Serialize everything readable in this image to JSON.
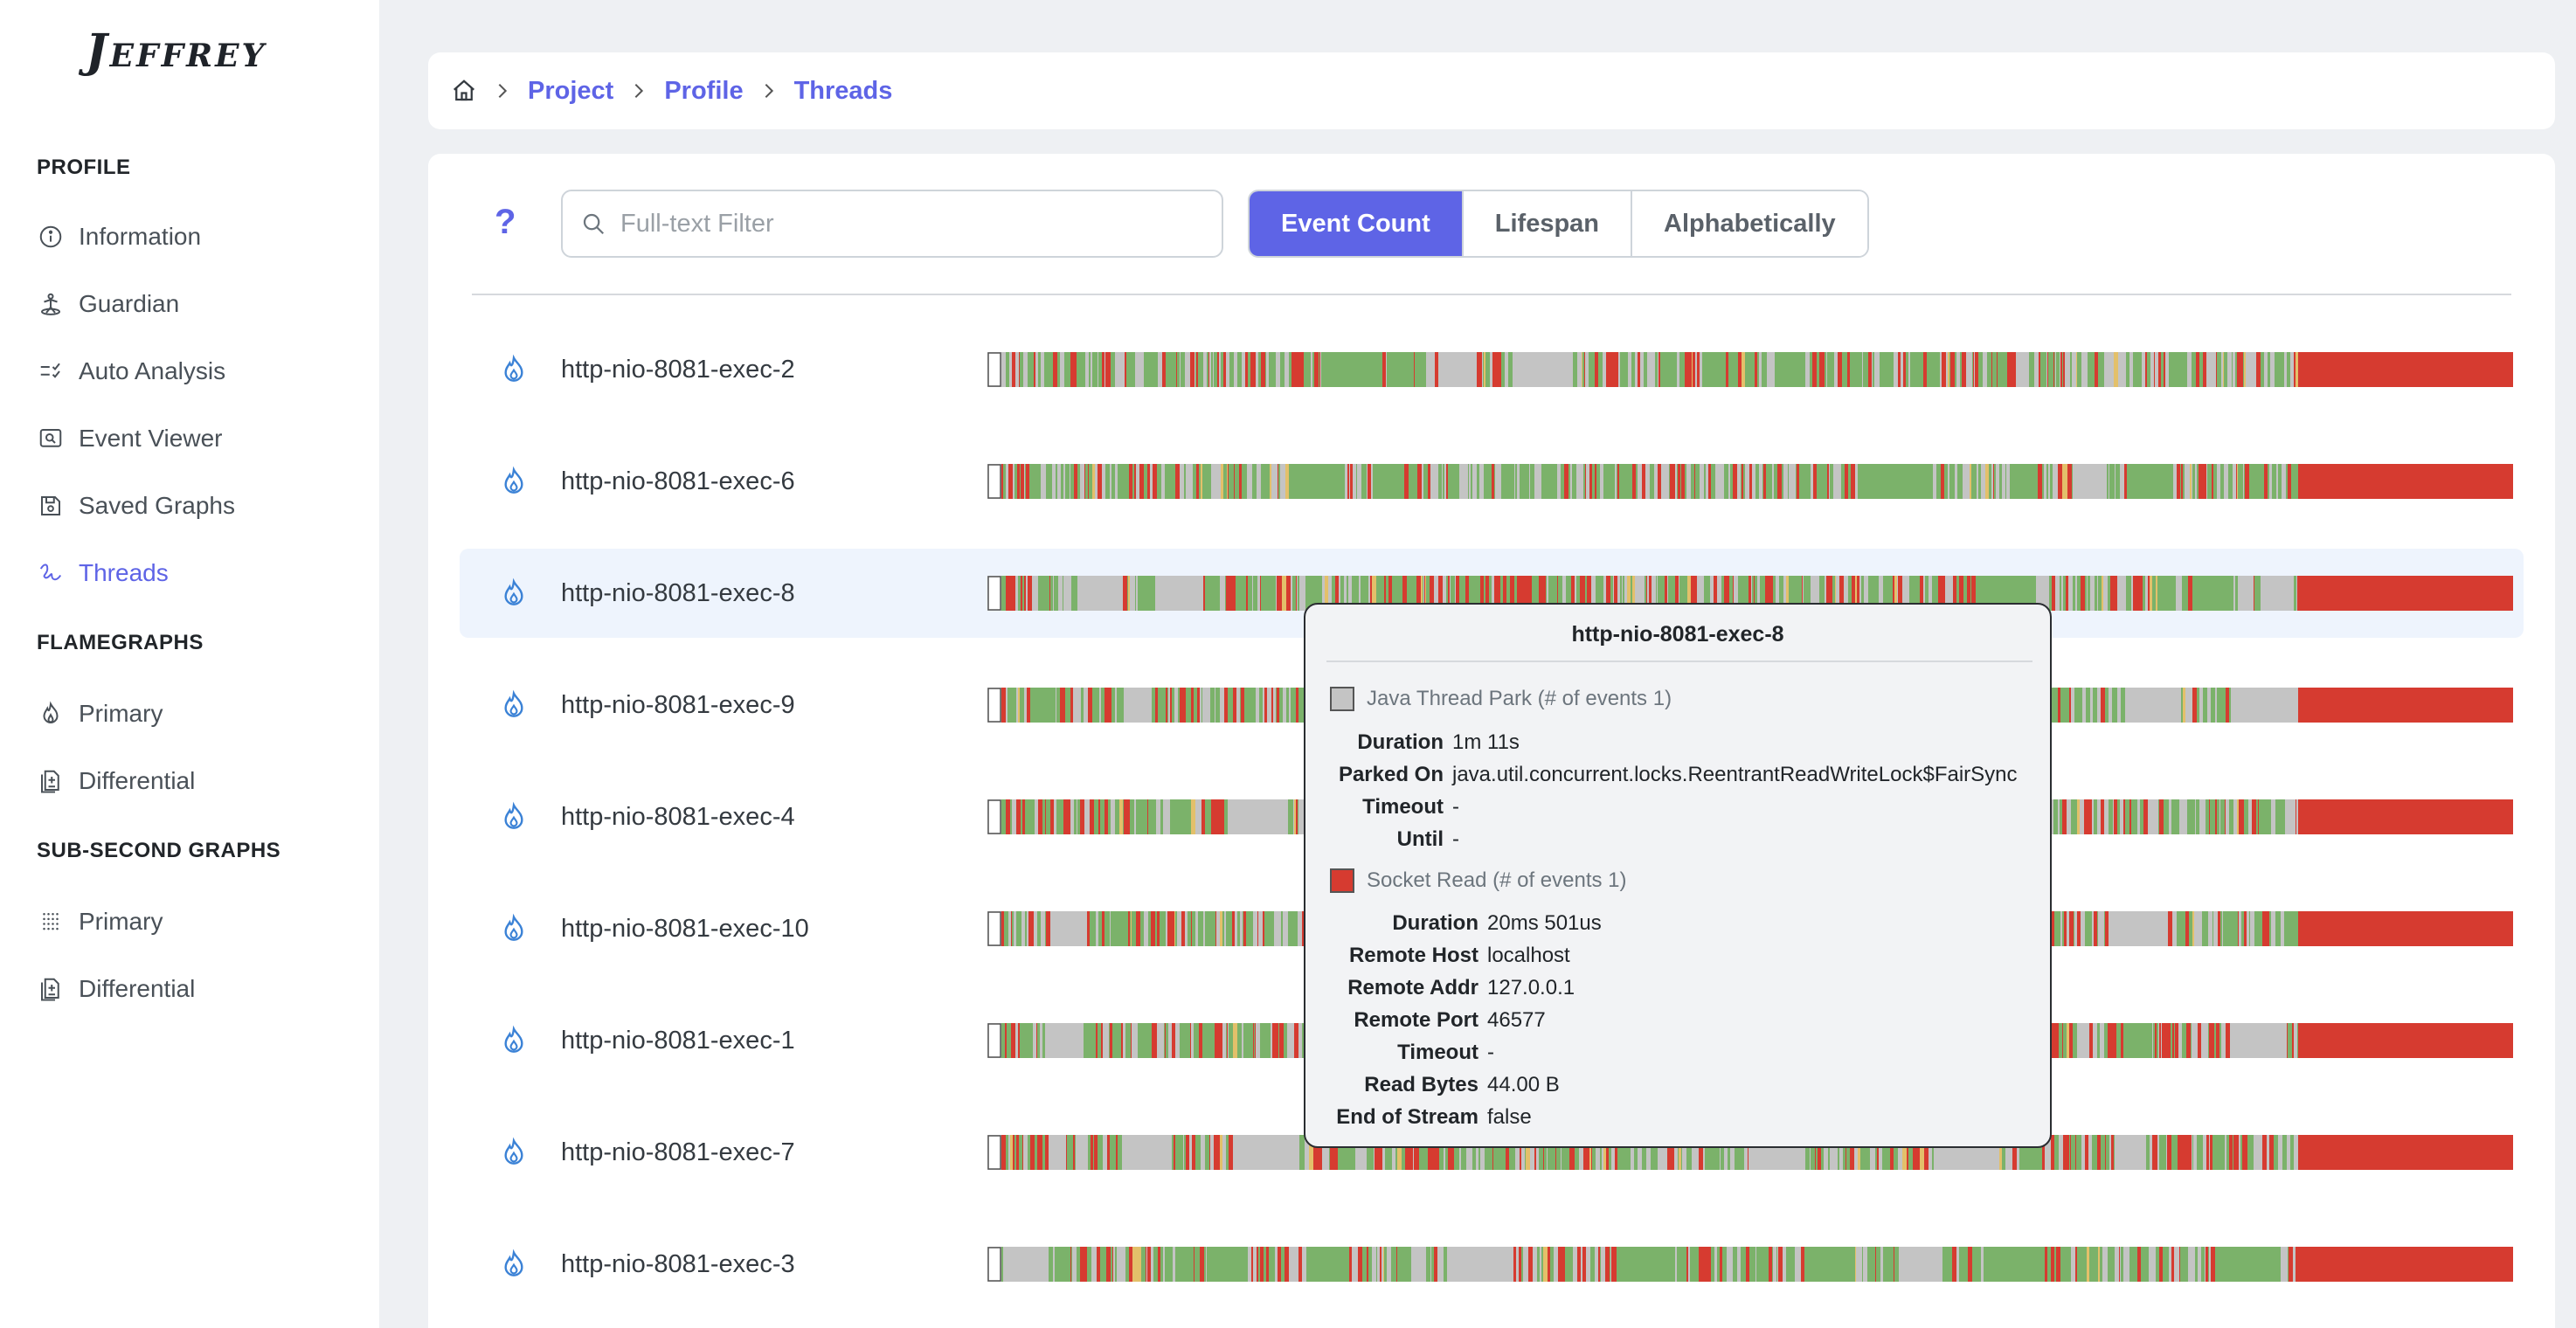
{
  "app": {
    "logo": "Jeffrey"
  },
  "sidebar": {
    "sections": [
      {
        "title": "PROFILE",
        "items": [
          {
            "label": "Information",
            "icon": "info-icon"
          },
          {
            "label": "Guardian",
            "icon": "guardian-icon"
          },
          {
            "label": "Auto Analysis",
            "icon": "checklist-icon"
          },
          {
            "label": "Event Viewer",
            "icon": "event-viewer-icon"
          },
          {
            "label": "Saved Graphs",
            "icon": "save-icon"
          },
          {
            "label": "Threads",
            "icon": "threads-icon",
            "active": true
          }
        ]
      },
      {
        "title": "FLAMEGRAPHS",
        "items": [
          {
            "label": "Primary",
            "icon": "flame-icon"
          },
          {
            "label": "Differential",
            "icon": "document-diff-icon"
          }
        ]
      },
      {
        "title": "SUB-SECOND GRAPHS",
        "items": [
          {
            "label": "Primary",
            "icon": "grid-icon"
          },
          {
            "label": "Differential",
            "icon": "document-diff-icon"
          }
        ]
      }
    ]
  },
  "breadcrumb": {
    "home_icon": "home-icon",
    "items": [
      "Project",
      "Profile",
      "Threads"
    ]
  },
  "toolbar": {
    "help_label": "?",
    "search_placeholder": "Full-text Filter",
    "search_value": "",
    "sort_options": [
      "Event Count",
      "Lifespan",
      "Alphabetically"
    ],
    "sort_selected": "Event Count"
  },
  "threads": [
    "http-nio-8081-exec-2",
    "http-nio-8081-exec-6",
    "http-nio-8081-exec-8",
    "http-nio-8081-exec-9",
    "http-nio-8081-exec-4",
    "http-nio-8081-exec-10",
    "http-nio-8081-exec-1",
    "http-nio-8081-exec-7",
    "http-nio-8081-exec-3"
  ],
  "highlighted_thread": "http-nio-8081-exec-8",
  "colors": {
    "accent": "#5e64e6",
    "running": "#7bb26a",
    "park": "#c4c4c4",
    "socket_read": "#d63b30",
    "wait": "#e3c06a"
  },
  "tooltip": {
    "title": "http-nio-8081-exec-8",
    "events": [
      {
        "name": "Java Thread Park (# of events 1)",
        "color": "#c4c4c4",
        "fields": [
          {
            "key": "Duration",
            "value": "1m 11s"
          },
          {
            "key": "Parked On",
            "value": "java.util.concurrent.locks.ReentrantReadWriteLock$FairSync"
          },
          {
            "key": "Timeout",
            "value": "-"
          },
          {
            "key": "Until",
            "value": "-"
          }
        ]
      },
      {
        "name": "Socket Read (# of events 1)",
        "color": "#d63b30",
        "fields": [
          {
            "key": "Duration",
            "value": "20ms 501us"
          },
          {
            "key": "Remote Host",
            "value": "localhost"
          },
          {
            "key": "Remote Addr",
            "value": "127.0.0.1"
          },
          {
            "key": "Remote Port",
            "value": "46577"
          },
          {
            "key": "Timeout",
            "value": "-"
          },
          {
            "key": "Read Bytes",
            "value": "44.00 B"
          },
          {
            "key": "End of Stream",
            "value": "false"
          }
        ]
      }
    ]
  }
}
